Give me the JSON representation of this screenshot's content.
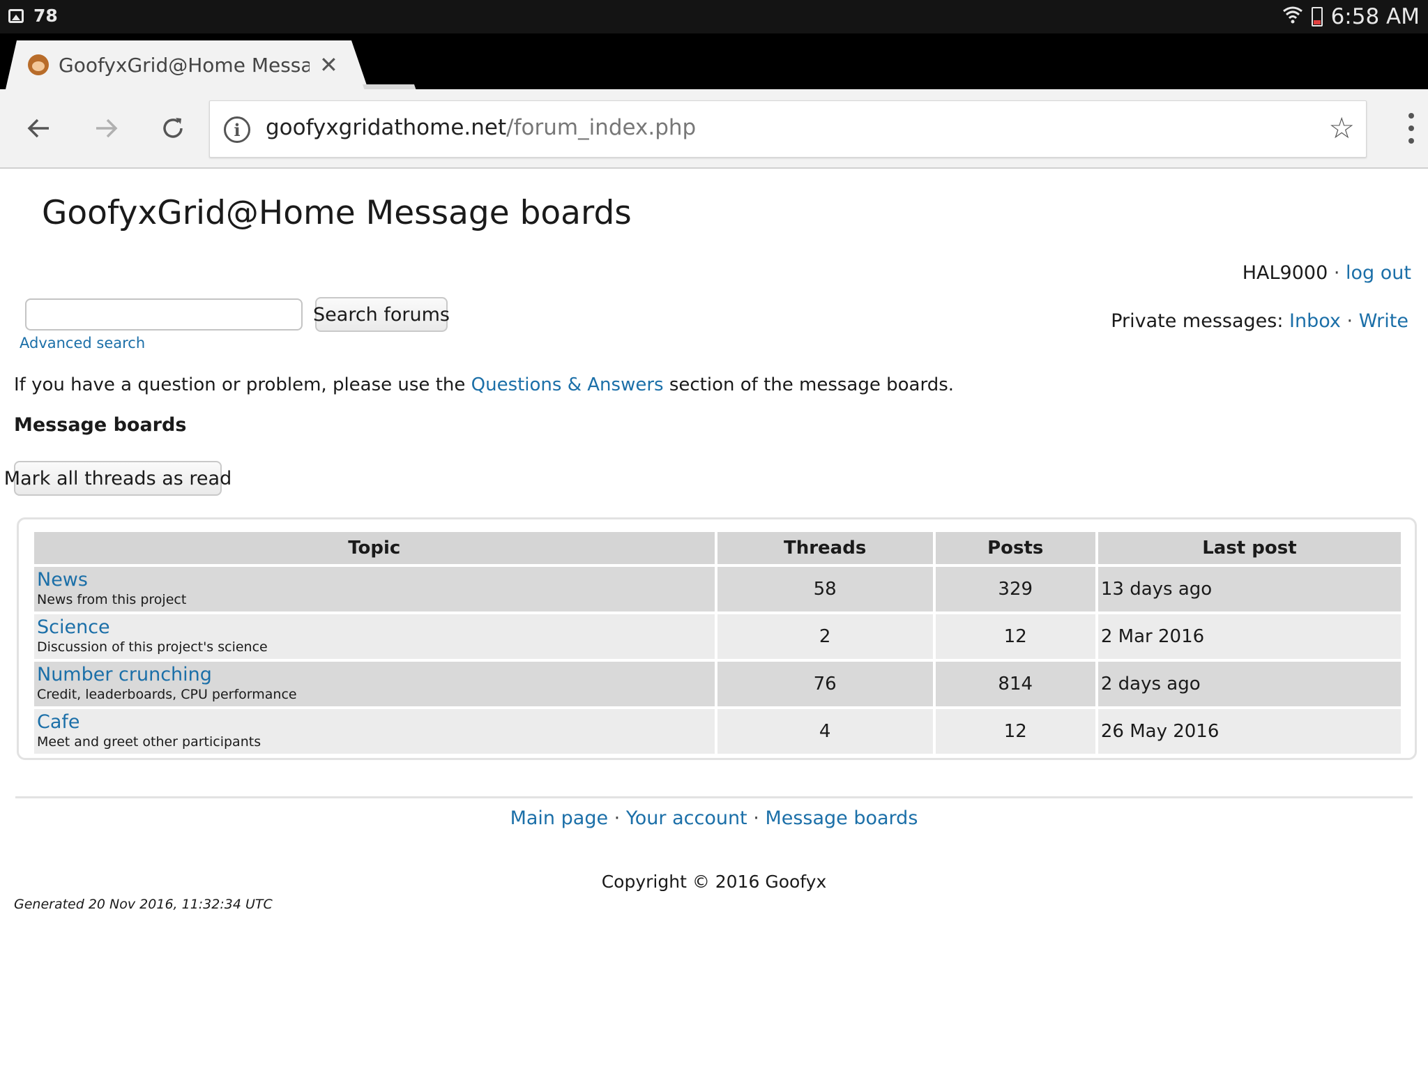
{
  "status_bar": {
    "notification_count": "78",
    "time": "6:58 AM"
  },
  "browser": {
    "tab_title": "GoofyxGrid@Home Message boards",
    "url_host": "goofyxgridathome.net",
    "url_path": "/forum_index.php"
  },
  "page": {
    "title": "GoofyxGrid@Home Message boards",
    "user": {
      "name": "HAL9000",
      "separator": "·",
      "logout_label": "log out"
    },
    "private_messages": {
      "label": "Private messages:",
      "inbox_label": "Inbox",
      "separator": "·",
      "write_label": "Write"
    },
    "search": {
      "input_value": "",
      "button_label": "Search forums",
      "advanced_label": "Advanced search"
    },
    "help": {
      "prefix": "If you have a question or problem, please use the ",
      "link_label": "Questions & Answers",
      "suffix": " section of the message boards."
    },
    "boards_heading": "Message boards",
    "mark_read_label": "Mark all threads as read",
    "table": {
      "headers": [
        "Topic",
        "Threads",
        "Posts",
        "Last post"
      ],
      "rows": [
        {
          "name": "News",
          "description": "News from this project",
          "threads": "58",
          "posts": "329",
          "last_post": "13 days ago"
        },
        {
          "name": "Science",
          "description": "Discussion of this project's science",
          "threads": "2",
          "posts": "12",
          "last_post": "2 Mar 2016"
        },
        {
          "name": "Number crunching",
          "description": "Credit, leaderboards, CPU performance",
          "threads": "76",
          "posts": "814",
          "last_post": "2 days ago"
        },
        {
          "name": "Cafe",
          "description": "Meet and greet other participants",
          "threads": "4",
          "posts": "12",
          "last_post": "26 May 2016"
        }
      ]
    },
    "footer": {
      "links": [
        "Main page",
        "Your account",
        "Message boards"
      ],
      "separator": "·",
      "copyright": "Copyright © 2016 Goofyx",
      "generated": "Generated 20 Nov 2016, 11:32:34 UTC"
    }
  },
  "colors": {
    "link": "#1b6fa8",
    "header_cell": "#d5d5d5",
    "row_dark": "#d9d9d9",
    "row_light": "#ececec",
    "status_bar": "#141414"
  },
  "icons": [
    "gallery-icon",
    "wifi-icon",
    "battery-icon",
    "monkey-favicon-icon",
    "close-icon",
    "back-arrow-icon",
    "forward-arrow-icon",
    "reload-icon",
    "info-icon",
    "star-icon",
    "menu-dots-icon"
  ]
}
